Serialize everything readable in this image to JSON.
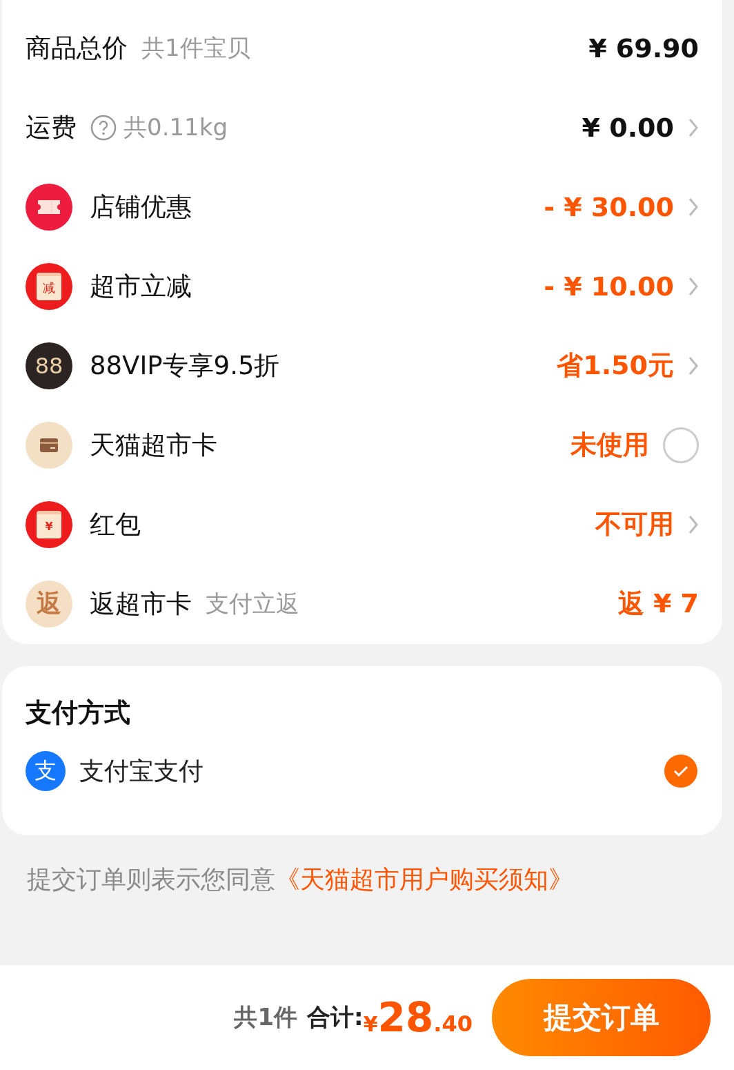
{
  "price_rows": [
    {
      "kind": "plain",
      "label": "商品总价",
      "note": "共1件宝贝",
      "value": "¥ 69.90",
      "accent": false,
      "chevron": false
    },
    {
      "kind": "plain",
      "label": "运费",
      "help": true,
      "note": "共0.11kg",
      "value": "¥ 0.00",
      "accent": false,
      "chevron": true
    },
    {
      "kind": "ticket",
      "label": "店铺优惠",
      "value": "- ¥ 30.00",
      "accent": true,
      "chevron": true
    },
    {
      "kind": "reduce",
      "icon_text": "减",
      "label": "超市立减",
      "value": "- ¥ 10.00",
      "accent": true,
      "chevron": true
    },
    {
      "kind": "vip",
      "icon_text": "88",
      "label": "88VIP专享9.5折",
      "value": "省1.50元",
      "accent": true,
      "chevron": true
    },
    {
      "kind": "card",
      "label": "天猫超市卡",
      "value": "未使用",
      "accent": true,
      "chevron": false,
      "checked": false
    },
    {
      "kind": "redpacket",
      "icon_text": "¥",
      "label": "红包",
      "value": "不可用",
      "accent": true,
      "chevron": true
    },
    {
      "kind": "rebate",
      "icon_text": "返",
      "label": "返超市卡",
      "note": "支付立返",
      "value": "返 ¥ 7",
      "accent": true,
      "chevron": false
    }
  ],
  "payment": {
    "title": "支付方式",
    "methods": [
      {
        "icon_text": "支",
        "label": "支付宝支付",
        "selected": true
      }
    ]
  },
  "agreement": {
    "text": "提交订单则表示您同意",
    "link": "《天猫超市用户购买须知》"
  },
  "footer": {
    "count": "共1件",
    "total_label": "合计:",
    "currency": "¥",
    "integer": "28",
    "decimal": ".40",
    "submit": "提交订单"
  }
}
